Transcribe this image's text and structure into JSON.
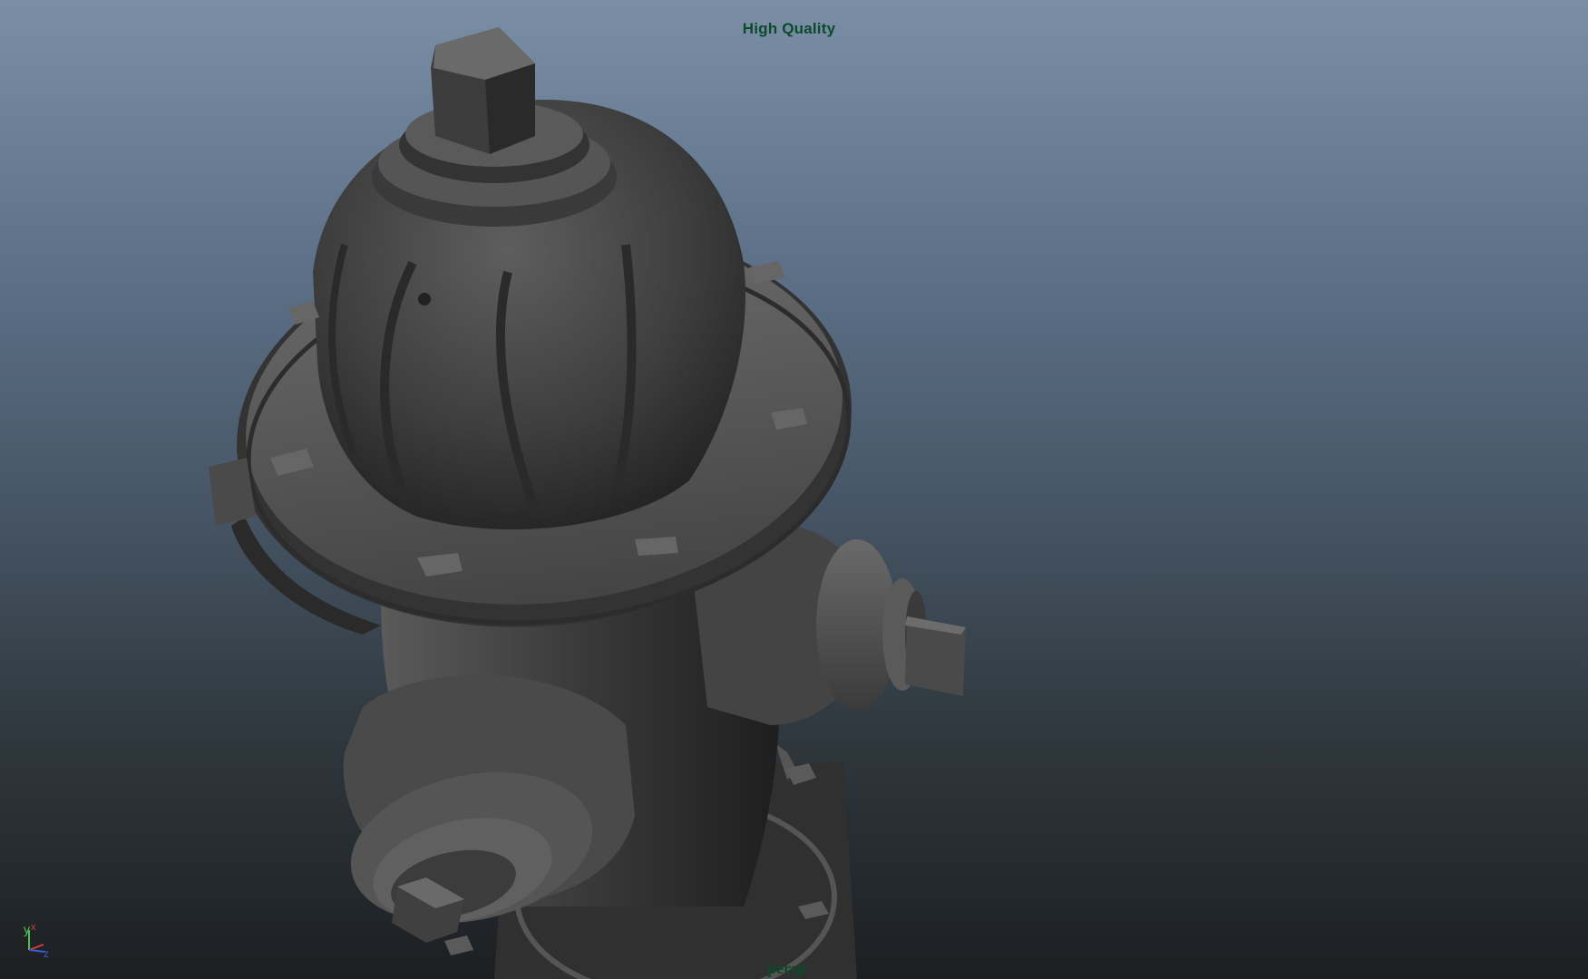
{
  "viewport": {
    "quality_label": "High Quality",
    "camera_label": "persp",
    "background_top": "#7a8ea6",
    "background_bottom": "#1c1f22",
    "hud_text_color": "#0b4a2a"
  },
  "scene": {
    "object": "fire-hydrant-model",
    "shading": "smooth-shaded-gray",
    "model_color": "#4a4a4a"
  },
  "axis_gizmo": {
    "labels": [
      "y",
      "x",
      "z"
    ],
    "colors": {
      "x": "#d23c3c",
      "y": "#4fc04f",
      "z": "#3c5ad2"
    }
  }
}
